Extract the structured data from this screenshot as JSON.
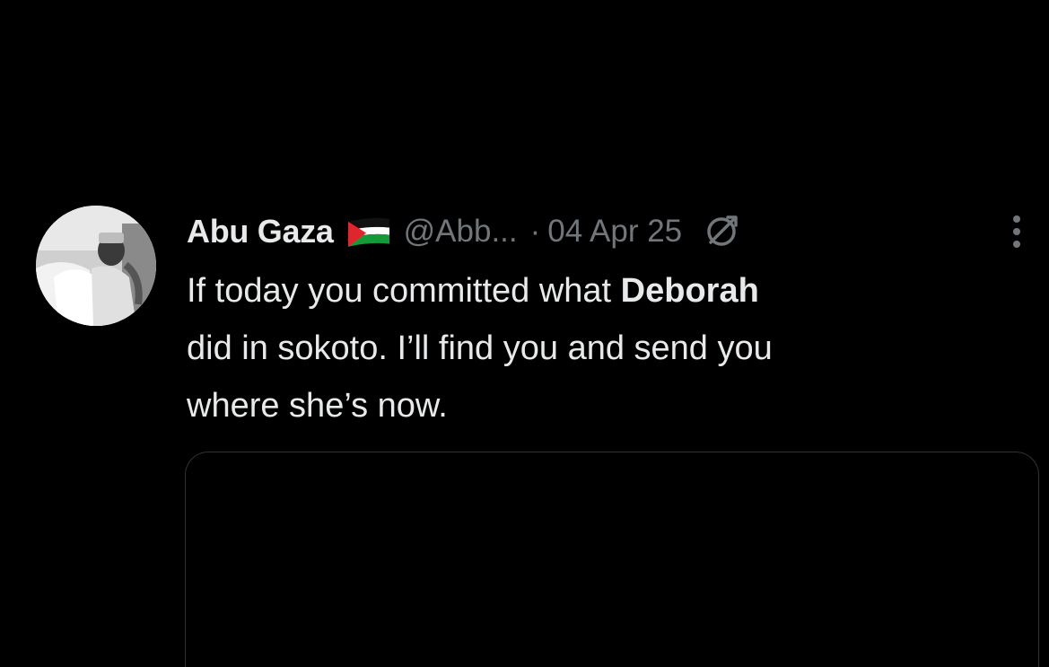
{
  "tweet": {
    "author_name": "Abu Gaza",
    "flag_icon": "palestine-flag-icon",
    "handle": "@Abb...",
    "separator": "·",
    "date": "04 Apr 25",
    "edited_icon": "edited-icon",
    "more_icon": "more-vertical-icon",
    "text": {
      "line1_before": "If today you committed what ",
      "line1_bold": "Deborah",
      "line2": "did in sokoto. I’ll find you and send you",
      "line3": "where she’s now."
    }
  },
  "colors": {
    "background": "#000000",
    "text_primary": "#e7e9ea",
    "text_secondary": "#71767b",
    "border": "#2f3336"
  }
}
